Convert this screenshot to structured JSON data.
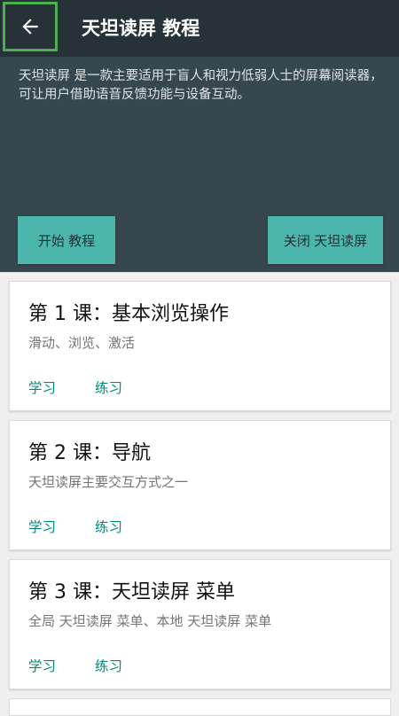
{
  "app_bar": {
    "title": "天坦读屏 教程",
    "back_icon": "arrow-left-icon"
  },
  "header": {
    "description": "天坦读屏 是一款主要适用于盲人和视力低弱人士的屏幕阅读器，可让用户借助语音反馈功能与设备互动。",
    "start_button": "开始 教程",
    "close_button": "关闭 天坦读屏"
  },
  "lessons": [
    {
      "title": "第 1 课：基本浏览操作",
      "subtitle": "滑动、浏览、激活",
      "learn": "学习",
      "practice": "练习"
    },
    {
      "title": "第 2 课：导航",
      "subtitle": "天坦读屏主要交互方式之一",
      "learn": "学习",
      "practice": "练习"
    },
    {
      "title": "第 3 课：天坦读屏 菜单",
      "subtitle": "全局 天坦读屏 菜单、本地 天坦读屏 菜单",
      "learn": "学习",
      "practice": "练习"
    }
  ],
  "colors": {
    "app_bar": "#263238",
    "header_panel": "#37474f",
    "accent_button": "#4db6ac",
    "link": "#00897b",
    "focus_border": "#4caf50"
  }
}
